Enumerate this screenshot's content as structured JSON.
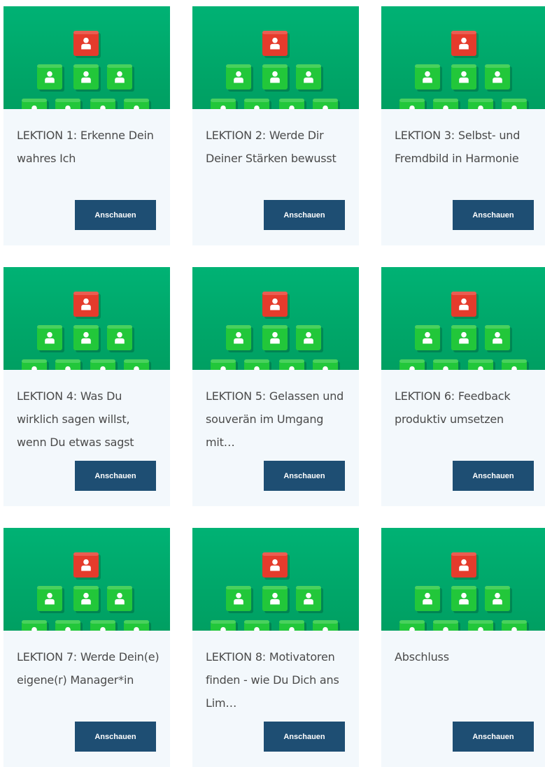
{
  "colors": {
    "card_background": "#f3f8fc",
    "image_background": "#00a86b",
    "block_green": "#22c73a",
    "block_red": "#e53b2c",
    "button_background": "#1e4e73",
    "button_text": "#ffffff",
    "title_text": "#4a4a4a"
  },
  "image": {
    "description_icon": "person-blocks-pyramid-icon"
  },
  "cards": [
    {
      "title": "LEKTION 1: Erkenne Dein wahres Ich",
      "button": "Anschauen"
    },
    {
      "title": "LEKTION 2: Werde Dir Deiner Stärken bewusst",
      "button": "Anschauen"
    },
    {
      "title": "LEKTION 3: Selbst- und Fremdbild in Harmonie",
      "button": "Anschauen"
    },
    {
      "title": "LEKTION 4: Was Du wirklich sagen willst, wenn Du etwas sagst",
      "button": "Anschauen"
    },
    {
      "title": "LEKTION 5: Gelassen und souverän im Umgang mit…",
      "button": "Anschauen"
    },
    {
      "title": "LEKTION 6: Feedback produktiv umsetzen",
      "button": "Anschauen"
    },
    {
      "title": "LEKTION 7: Werde Dein(e) eigene(r) Manager*in",
      "button": "Anschauen"
    },
    {
      "title": "LEKTION 8: Motivatoren finden - wie Du Dich ans Lim…",
      "button": "Anschauen"
    },
    {
      "title": "Abschluss",
      "button": "Anschauen"
    }
  ]
}
